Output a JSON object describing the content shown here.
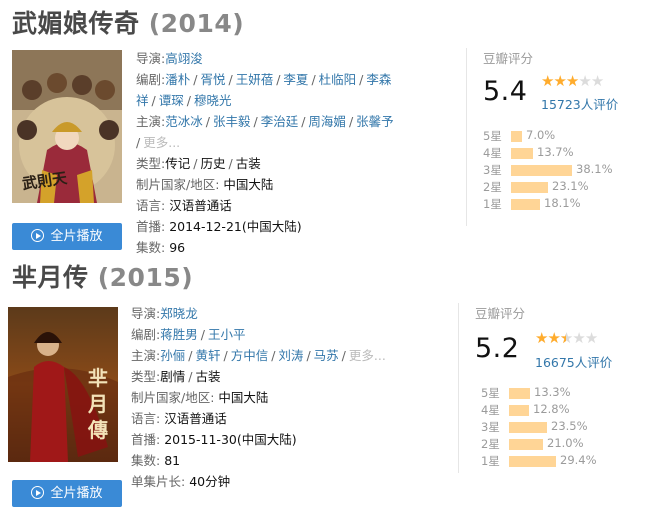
{
  "movies": [
    {
      "title": "武媚娘传奇",
      "year": "(2014)",
      "poster_text": "武則天",
      "director_label": "导演:",
      "director": [
        "高翊浚"
      ],
      "writer_label": "编剧:",
      "writers_line1": [
        "潘朴",
        "胥悦",
        "王妍蓓",
        "李夏",
        "杜临阳",
        "李森"
      ],
      "writers_line2": [
        "祥",
        "谭琛",
        "穆晓光"
      ],
      "cast_label": "主演:",
      "cast": [
        "范冰冰",
        "张丰毅",
        "李治廷",
        "周海媚",
        "张馨予"
      ],
      "more_label": "更多...",
      "genre_label": "类型:",
      "genres": [
        "传记",
        "历史",
        "古装"
      ],
      "region_label": "制片国家/地区:",
      "region": "中国大陆",
      "language_label": "语言:",
      "language": "汉语普通话",
      "premiere_label": "首播:",
      "premiere": "2014-12-21(中国大陆)",
      "episodes_label": "集数:",
      "episodes": "96",
      "play_label": "全片播放",
      "rating_label": "豆瓣评分",
      "score": "5.4",
      "votes": "15723人评价",
      "star_levels": [
        "5星",
        "4星",
        "3星",
        "2星",
        "1星"
      ],
      "star_pcts": [
        7.0,
        13.7,
        38.1,
        23.1,
        18.1
      ],
      "star_pct_labels": [
        "7.0%",
        "13.7%",
        "38.1%",
        "23.1%",
        "18.1%"
      ],
      "stars_shown": 3.0
    },
    {
      "title": "芈月传",
      "year": "(2015)",
      "poster_text": "芈月傳",
      "director_label": "导演:",
      "director": [
        "郑晓龙"
      ],
      "writer_label": "编剧:",
      "writers_line1": [
        "蒋胜男",
        "王小平"
      ],
      "cast_label": "主演:",
      "cast": [
        "孙俪",
        "黄轩",
        "方中信",
        "刘涛",
        "马苏"
      ],
      "more_label": "更多...",
      "genre_label": "类型:",
      "genres": [
        "剧情",
        "古装"
      ],
      "region_label": "制片国家/地区:",
      "region": "中国大陆",
      "language_label": "语言:",
      "language": "汉语普通话",
      "premiere_label": "首播:",
      "premiere": "2015-11-30(中国大陆)",
      "episodes_label": "集数:",
      "episodes": "81",
      "runtime_label": "单集片长:",
      "runtime": "40分钟",
      "play_label": "全片播放",
      "rating_label": "豆瓣评分",
      "score": "5.2",
      "votes": "16675人评价",
      "star_levels": [
        "5星",
        "4星",
        "3星",
        "2星",
        "1星"
      ],
      "star_pcts": [
        13.3,
        12.8,
        23.5,
        21.0,
        29.4
      ],
      "star_pct_labels": [
        "13.3%",
        "12.8%",
        "23.5%",
        "21.0%",
        "29.4%"
      ],
      "stars_shown": 2.5
    }
  ],
  "colors": {
    "link": "#3377aa",
    "star": "#ffac2d",
    "bar": "#ffd596",
    "button": "#3a8ad6"
  },
  "icons": {
    "play": "play-circle-icon",
    "star": "star-icon"
  }
}
